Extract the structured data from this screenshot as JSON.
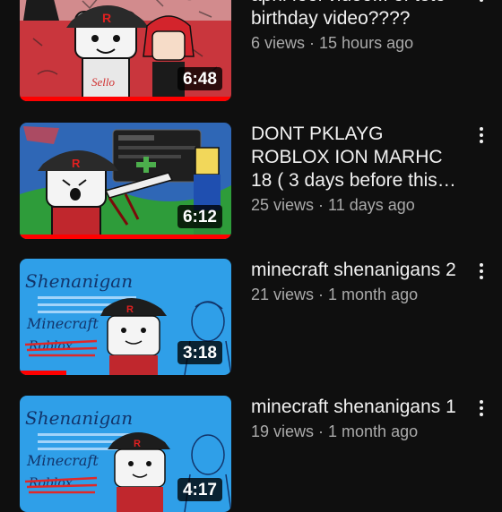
{
  "feed": {
    "videos": [
      {
        "title": "april fool video... of teto birthday video????",
        "title_visible": "april fool video... of teto birthday video????",
        "meta": "6 views · 15 hours ago",
        "duration": "6:48",
        "watched_fraction": 1.0
      },
      {
        "title": "DONT PKLAYG ROBLOX ION MARHC 18 ( 3 days before this…",
        "meta": "25 views · 11 days ago",
        "duration": "6:12",
        "watched_fraction": 1.0
      },
      {
        "title": "minecraft shenanigans 2",
        "meta": "21 views · 1 month ago",
        "duration": "3:18",
        "watched_fraction": 0.22
      },
      {
        "title": "minecraft shenanigans 1",
        "meta": "19 views · 1 month ago",
        "duration": "4:17",
        "watched_fraction": 0.0
      }
    ]
  },
  "thumbnail_text": {
    "brand_letter": "R",
    "sign": "Sello",
    "shenanigan": "Shenanigan",
    "minecraft": "Minecraft",
    "roblox": "Roblox"
  },
  "colors": {
    "background": "#0f0f0f",
    "title": "#f1f1f1",
    "meta": "#aaaaaa",
    "progress": "#ff0000"
  },
  "icons": {
    "more": "more-vert-icon"
  }
}
